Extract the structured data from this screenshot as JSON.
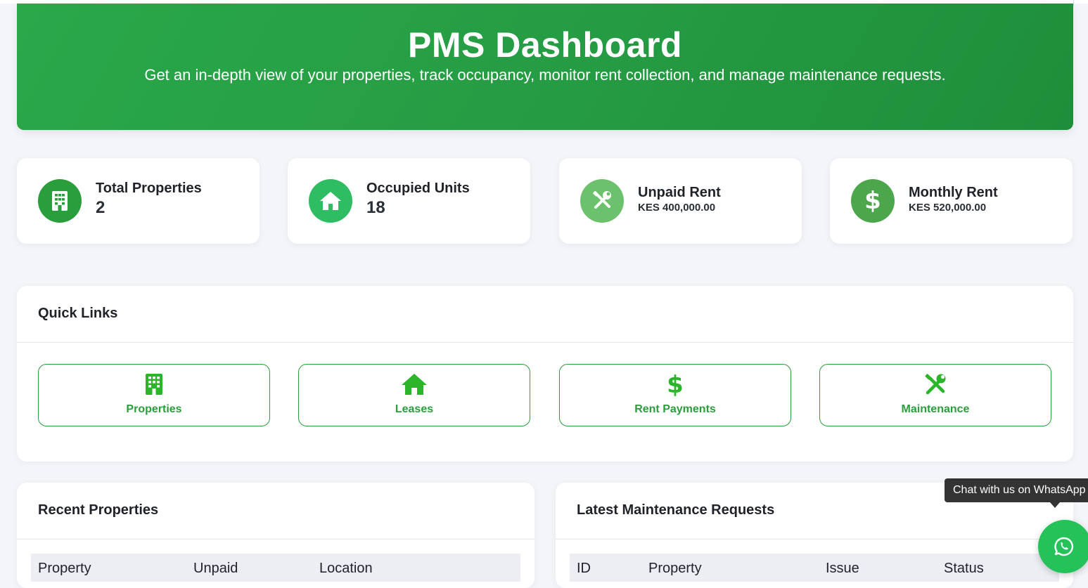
{
  "hero": {
    "title": "PMS Dashboard",
    "subtitle": "Get an in-depth view of your properties, track occupancy, monitor rent collection, and manage maintenance requests."
  },
  "stats": [
    {
      "title": "Total Properties",
      "value": "2",
      "icon": "building-icon",
      "color": "#2a9d3c"
    },
    {
      "title": "Occupied Units",
      "value": "18",
      "icon": "home-icon",
      "color": "#2ebd62"
    },
    {
      "title": "Unpaid Rent",
      "value": "KES 400,000.00",
      "icon": "tools-icon",
      "color": "#6cc26c"
    },
    {
      "title": "Monthly Rent",
      "value": "KES 520,000.00",
      "icon": "dollar-icon",
      "color": "#4ca64c"
    }
  ],
  "quick_links": {
    "title": "Quick Links",
    "items": [
      {
        "label": "Properties",
        "icon": "building-icon"
      },
      {
        "label": "Leases",
        "icon": "home-icon"
      },
      {
        "label": "Rent Payments",
        "icon": "dollar-icon"
      },
      {
        "label": "Maintenance",
        "icon": "tools-icon"
      }
    ]
  },
  "recent_properties": {
    "title": "Recent Properties",
    "columns": [
      "Property",
      "Unpaid",
      "Location"
    ]
  },
  "maintenance": {
    "title": "Latest Maintenance Requests",
    "columns": [
      "ID",
      "Property",
      "Issue",
      "Status"
    ]
  },
  "whatsapp": {
    "tooltip": "Chat with us on WhatsApp",
    "icon": "whatsapp-icon",
    "color": "#25c25a"
  },
  "colors": {
    "accent": "#2a9d3c",
    "hero": "#28a745",
    "background": "#f3f5f9"
  }
}
